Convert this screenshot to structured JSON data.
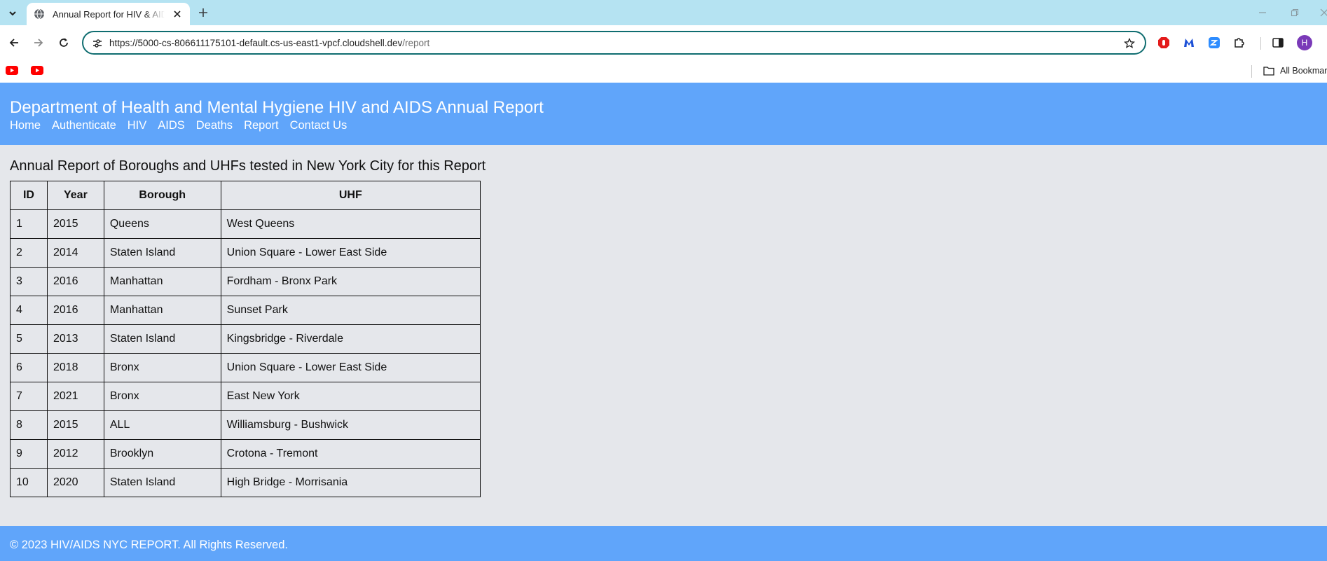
{
  "browser": {
    "tab": {
      "title": "Annual Report for HIV & AIDS in NYC"
    },
    "address_bar": {
      "url_host": "https://5000-cs-806611175101-default.cs-us-east1-vpcf.cloudshell.dev",
      "url_path": "/report"
    },
    "profile_initial": "H",
    "bookmarks": {
      "items": [
        {
          "icon": "youtube-icon"
        },
        {
          "icon": "youtube-icon"
        }
      ],
      "all_bookmarks_label": "All Bookmarks"
    },
    "colors": {
      "tabstrip": "#b5e3f2",
      "omnibox_border": "#0f6d70"
    }
  },
  "header": {
    "title": "Department of Health and Mental Hygiene HIV and AIDS Annual Report",
    "nav": [
      "Home",
      "Authenticate",
      "HIV",
      "AIDS",
      "Deaths",
      "Report",
      "Contact Us"
    ]
  },
  "main": {
    "heading": "Annual Report of Boroughs and UHFs tested in New York City for this Report",
    "table": {
      "columns": [
        "ID",
        "Year",
        "Borough",
        "UHF"
      ],
      "rows": [
        [
          "1",
          "2015",
          "Queens",
          "West Queens"
        ],
        [
          "2",
          "2014",
          "Staten Island",
          "Union Square - Lower East Side"
        ],
        [
          "3",
          "2016",
          "Manhattan",
          "Fordham - Bronx Park"
        ],
        [
          "4",
          "2016",
          "Manhattan",
          "Sunset Park"
        ],
        [
          "5",
          "2013",
          "Staten Island",
          "Kingsbridge - Riverdale"
        ],
        [
          "6",
          "2018",
          "Bronx",
          "Union Square - Lower East Side"
        ],
        [
          "7",
          "2021",
          "Bronx",
          "East New York"
        ],
        [
          "8",
          "2015",
          "ALL",
          "Williamsburg - Bushwick"
        ],
        [
          "9",
          "2012",
          "Brooklyn",
          "Crotona - Tremont"
        ],
        [
          "10",
          "2020",
          "Staten Island",
          "High Bridge - Morrisania"
        ]
      ]
    }
  },
  "footer": {
    "text": "© 2023 HIV/AIDS NYC REPORT. All Rights Reserved."
  },
  "theme": {
    "accent": "#60a5fa",
    "page_background": "#e5e7eb"
  }
}
